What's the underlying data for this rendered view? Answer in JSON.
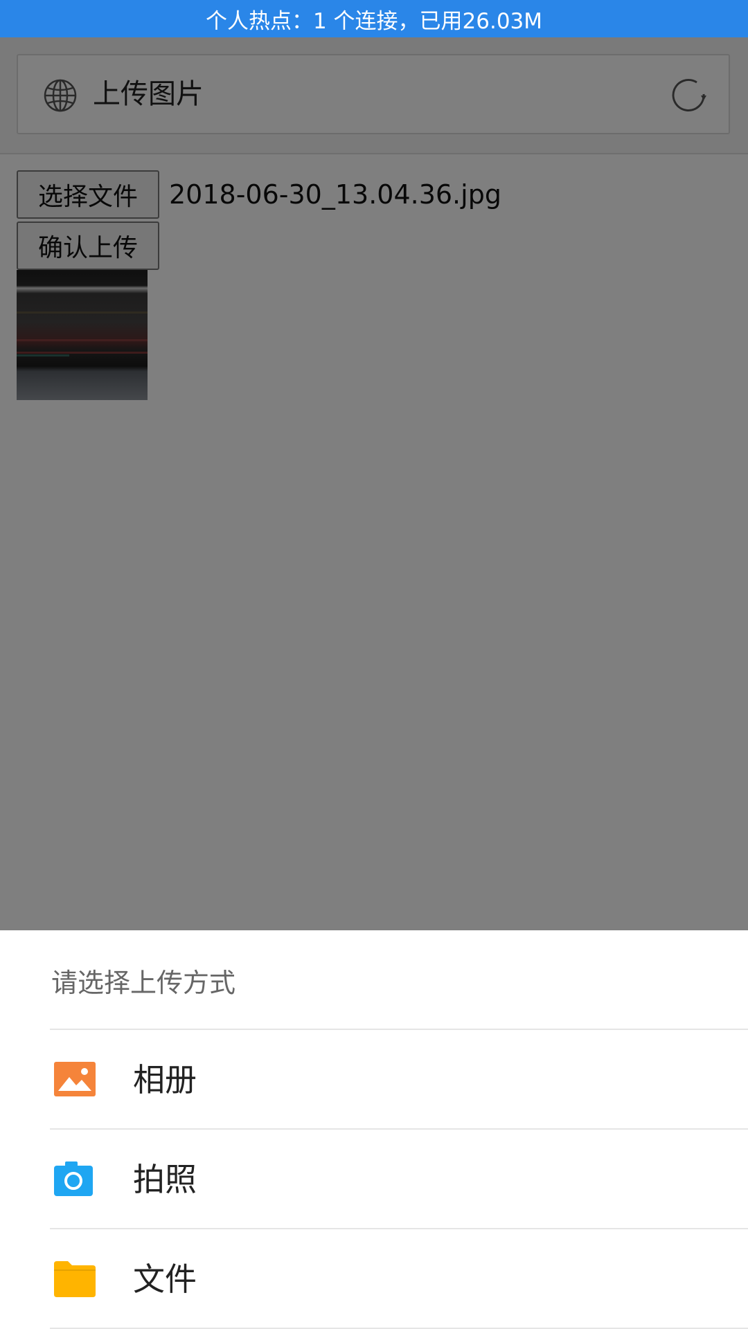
{
  "status_bar": {
    "text": "个人热点：1 个连接，已用26.03M"
  },
  "address_bar": {
    "title": "上传图片",
    "globe_icon": "globe-icon",
    "refresh_icon": "refresh-icon"
  },
  "form": {
    "choose_file_label": "选择文件",
    "file_name": "2018-06-30_13.04.36.jpg",
    "confirm_upload_label": "确认上传"
  },
  "sheet": {
    "title": "请选择上传方式",
    "options": [
      {
        "label": "相册",
        "icon": "gallery-icon",
        "color": "#f5843a"
      },
      {
        "label": "拍照",
        "icon": "camera-icon",
        "color": "#1fa6f2"
      },
      {
        "label": "文件",
        "icon": "folder-icon",
        "color": "#ffb400"
      }
    ]
  },
  "colors": {
    "status_bar": "#2a86e8",
    "overlay": "rgba(0,0,0,0.5)"
  }
}
